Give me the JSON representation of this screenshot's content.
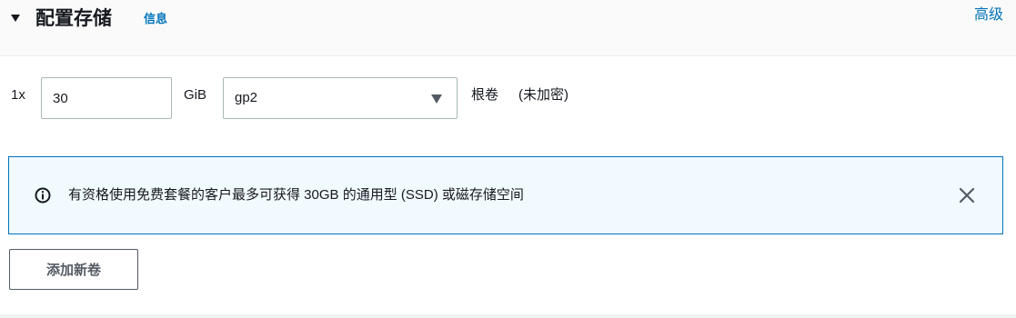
{
  "header": {
    "title": "配置存储",
    "info_link": "信息",
    "advanced_link": "高级",
    "caret_icon": "caret-down-icon"
  },
  "volume": {
    "count": "1x",
    "size_value": "30",
    "unit": "GiB",
    "type_value": "gp2",
    "root_label": "根卷",
    "encryption_label": "(未加密)"
  },
  "alert": {
    "icon": "info-icon",
    "message": "有资格使用免费套餐的客户最多可获得 30GB 的通用型 (SSD) 或磁存储空间",
    "close_icon": "close-icon",
    "border_color": "#0073bb",
    "background_color": "#f1faff"
  },
  "actions": {
    "add_volume": "添加新卷"
  },
  "colors": {
    "link": "#0073bb",
    "text": "#16191f"
  }
}
